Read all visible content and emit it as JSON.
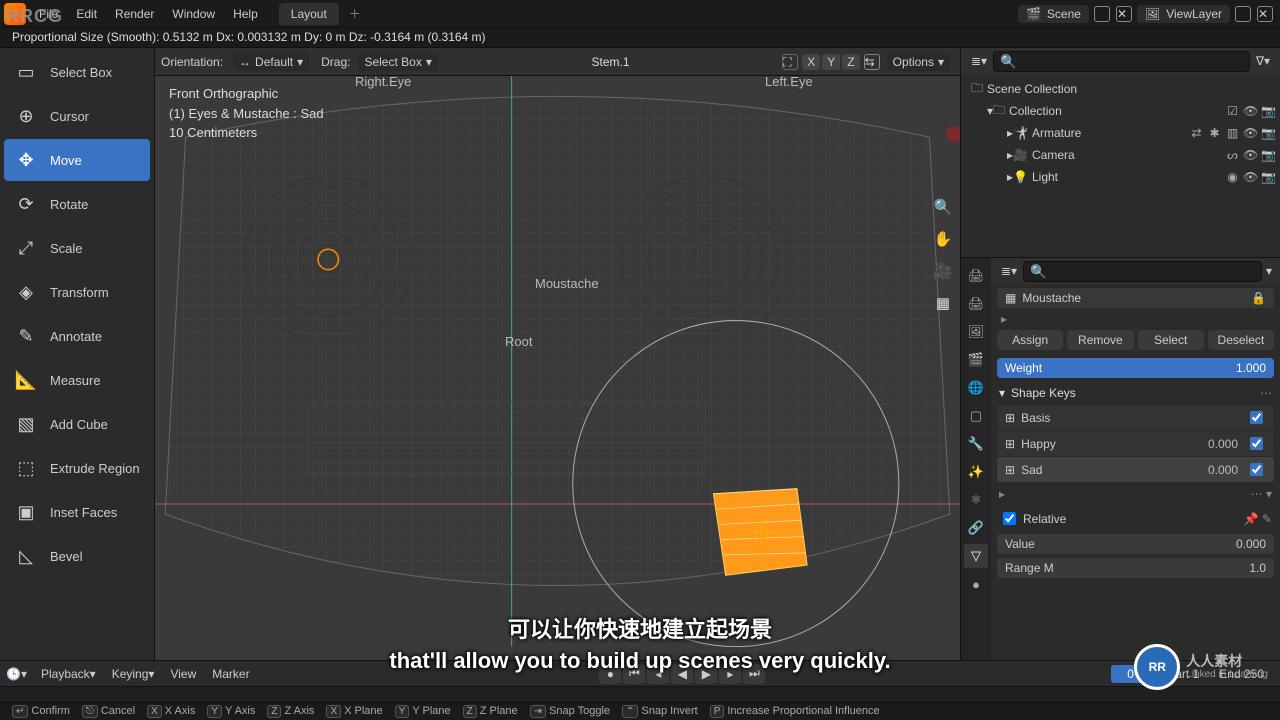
{
  "watermarks": {
    "tl": "RRCG",
    "br_text": "人人素材",
    "br_badge": "RR",
    "linkedin": "Linked in Learning"
  },
  "topmenu": {
    "items": [
      "File",
      "Edit",
      "Render",
      "Window",
      "Help"
    ],
    "workspace": "Layout"
  },
  "scene": {
    "label": "Scene",
    "viewlayer": "ViewLayer"
  },
  "status": "Proportional Size (Smooth): 0.5132 m   Dx: 0.003132 m   Dy: 0 m   Dz: -0.3164 m (0.3164 m)",
  "vp_header": {
    "orientation_label": "Orientation:",
    "orientation_value": "Default",
    "drag_label": "Drag:",
    "drag_value": "Select Box",
    "breadcrumb": "Stem.1",
    "options": "Options",
    "axes": [
      "X",
      "Y",
      "Z"
    ]
  },
  "tools": [
    {
      "label": "Select Box",
      "icon": "▭"
    },
    {
      "label": "Cursor",
      "icon": "⊕"
    },
    {
      "label": "Move",
      "icon": "✥",
      "active": true
    },
    {
      "label": "Rotate",
      "icon": "⟳"
    },
    {
      "label": "Scale",
      "icon": "⤢"
    },
    {
      "label": "Transform",
      "icon": "◈"
    },
    {
      "label": "Annotate",
      "icon": "✎"
    },
    {
      "label": "Measure",
      "icon": "📐"
    },
    {
      "label": "Add Cube",
      "icon": "▧"
    },
    {
      "label": "Extrude Region",
      "icon": "⬚"
    },
    {
      "label": "Inset Faces",
      "icon": "▣"
    },
    {
      "label": "Bevel",
      "icon": "◺"
    }
  ],
  "overlay": {
    "l1": "Front Orthographic",
    "l2": "(1) Eyes & Mustache : Sad",
    "l3": "10 Centimeters"
  },
  "annotations": {
    "right_eye": "Right.Eye",
    "left_eye": "Left.Eye",
    "moustache": "Moustache",
    "root": "Root"
  },
  "outliner": {
    "root": "Scene Collection",
    "collection": "Collection",
    "items": [
      {
        "label": "Armature",
        "icon": "🤺",
        "extra": [
          "⇄",
          "✱",
          "▥"
        ]
      },
      {
        "label": "Camera",
        "icon": "🎥",
        "extra": [
          "ᔕ"
        ]
      },
      {
        "label": "Light",
        "icon": "💡",
        "extra": [
          "◉"
        ]
      }
    ]
  },
  "properties": {
    "vg_name": "Moustache",
    "buttons": {
      "assign": "Assign",
      "remove": "Remove",
      "select": "Select",
      "deselect": "Deselect"
    },
    "weight_label": "Weight",
    "weight_value": "1.000",
    "shape_keys_title": "Shape Keys",
    "shape_keys": [
      {
        "name": "Basis",
        "value": "",
        "checked": true
      },
      {
        "name": "Happy",
        "value": "0.000",
        "checked": true
      },
      {
        "name": "Sad",
        "value": "0.000",
        "checked": true,
        "active": true
      }
    ],
    "relative": "Relative",
    "value_label": "Value",
    "value_num": "0.000",
    "range_label": "Range M",
    "range_max": "1.0"
  },
  "timeline": {
    "playback": "Playback",
    "keying": "Keying",
    "view": "View",
    "marker": "Marker",
    "current": "0",
    "start_label": "Start",
    "start": "1",
    "end_label": "End",
    "end": "250"
  },
  "footer": {
    "confirm": "Confirm",
    "cancel": "Cancel",
    "xaxis": "X Axis",
    "yaxis": "Y Axis",
    "zaxis": "Z Axis",
    "xplane": "X Plane",
    "yplane": "Y Plane",
    "zplane": "Z Plane",
    "snap_toggle": "Snap Toggle",
    "snap_invert": "Snap Invert",
    "prop": "Increase Proportional Influence"
  },
  "subtitles": {
    "cn": "可以让你快速地建立起场景",
    "en": "that'll allow you to build up scenes very quickly."
  }
}
